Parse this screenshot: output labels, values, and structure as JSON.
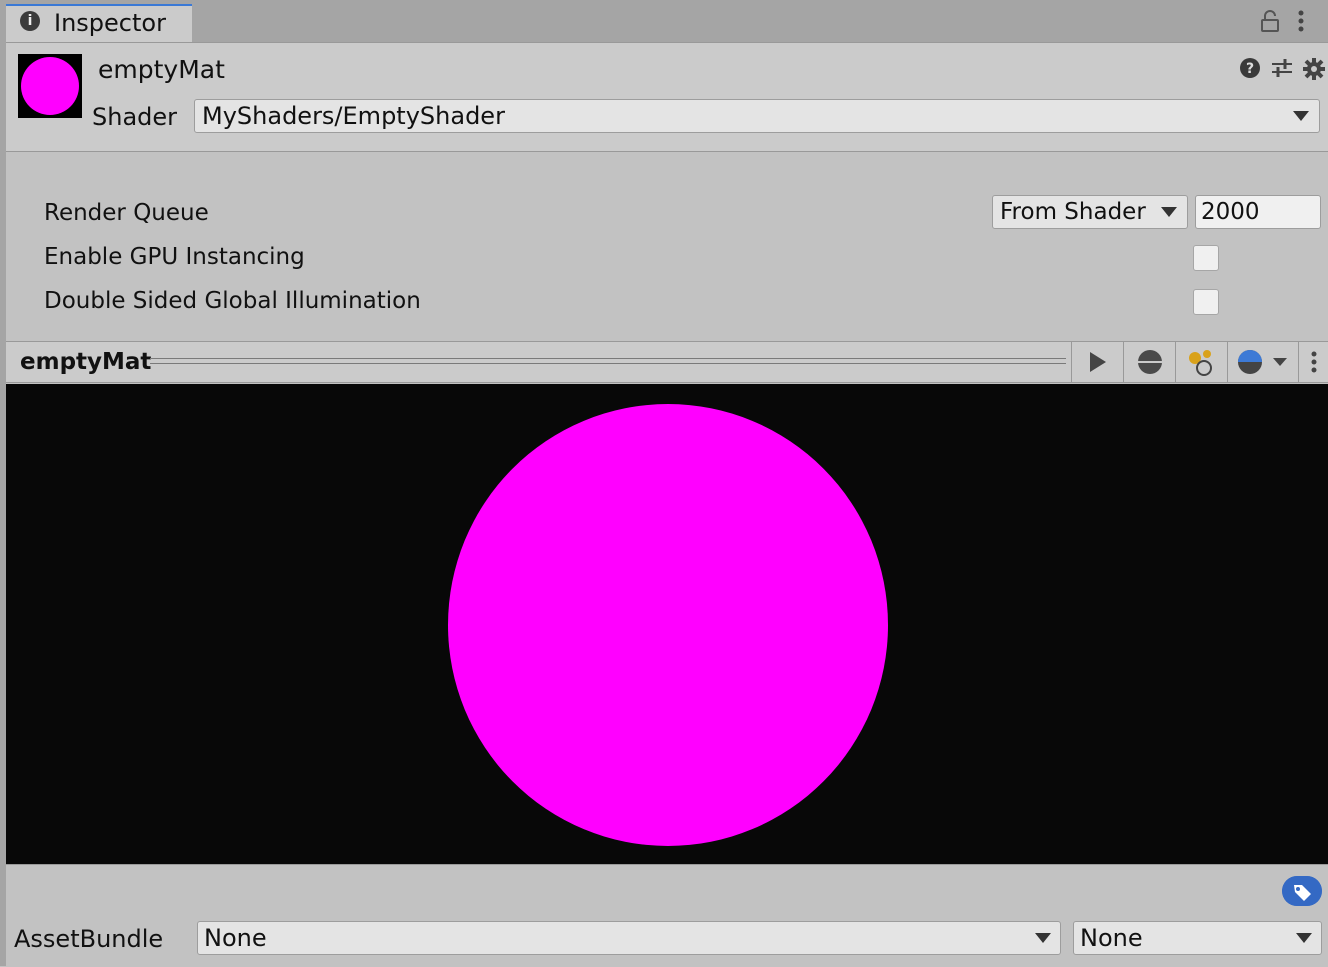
{
  "tab": {
    "label": "Inspector"
  },
  "material": {
    "name": "emptyMat",
    "shader_label": "Shader",
    "shader_value": "MyShaders/EmptyShader",
    "color": "#ff00ff"
  },
  "properties": {
    "render_queue": {
      "label": "Render Queue",
      "mode": "From Shader",
      "value": "2000"
    },
    "gpu_instancing": {
      "label": "Enable GPU Instancing",
      "checked": false
    },
    "double_sided_gi": {
      "label": "Double Sided Global Illumination",
      "checked": false
    }
  },
  "preview": {
    "title": "emptyMat",
    "background": "#080808",
    "sphere_color": "#ff00ff"
  },
  "footer": {
    "assetbundle_label": "AssetBundle",
    "bundle_name": "None",
    "bundle_variant": "None"
  },
  "icons": [
    "info-icon",
    "lock-icon",
    "kebab-menu-icon",
    "help-icon",
    "preset-icon",
    "gear-icon",
    "play-icon",
    "sphere-icon",
    "lights-icon",
    "preview-mesh-icon",
    "label-tag-icon"
  ],
  "colors": {
    "accent": "#3a79d6",
    "tag_blue": "#3469c4",
    "panel": "#cbcbcb"
  }
}
